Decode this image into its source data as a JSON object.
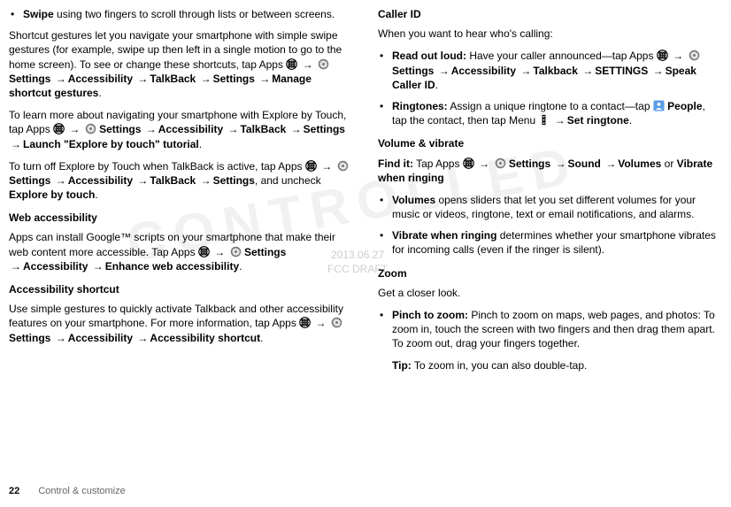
{
  "watermark": {
    "date": "2013.06.27",
    "label": "FCC DRAFT"
  },
  "left": {
    "swipe_bold": "Swipe",
    "swipe_rest": " using two fingers to scroll through lists or between screens.",
    "shortcut1": "Shortcut gestures let you navigate your smartphone with simple swipe gestures (for example, swipe up then left in a single motion to go to the home screen). To see or change these shortcuts, tap Apps ",
    "settings": "Settings",
    "accessibility": "Accessibility",
    "talkback": "TalkBack",
    "settings2": "Settings",
    "manage_gestures": "Manage shortcut gestures",
    "learn_more": "To learn more about navigating your smartphone with Explore by Touch, tap Apps ",
    "launch_tutorial": "Launch \"Explore by touch\" tutorial",
    "turnoff": "To turn off Explore by Touch when TalkBack is active, tap Apps ",
    "explore_by_touch": "Explore by touch",
    "uncheck_pre": ", and uncheck ",
    "web_heading": "Web accessibility",
    "web_text1": "Apps can install Google™ scripts on your smartphone that make their web content more accessible. Tap Apps ",
    "enhance_web": "Enhance web accessibility",
    "shortcut_heading": "Accessibility shortcut",
    "shortcut_text": "Use simple gestures to quickly activate Talkback and other accessibility features on your smartphone. For more information, tap Apps ",
    "accessibility_shortcut": "Accessibility shortcut"
  },
  "right": {
    "caller_heading": "Caller ID",
    "caller_intro": "When you want to hear who's calling:",
    "read_out": "Read out loud:",
    "read_rest": " Have your caller announced—tap Apps ",
    "talkback": "Talkback",
    "settings_caps": "SETTINGS",
    "speak_caller": "Speak Caller ID",
    "ringtones": "Ringtones:",
    "ringtones_rest": " Assign a unique ringtone to a contact—tap ",
    "people": "People",
    "tap_contact": ", tap the contact, then tap Menu ",
    "set_ringtone": "Set ringtone",
    "vol_heading": "Volume & vibrate",
    "find_it": "Find it:",
    "find_rest": " Tap Apps ",
    "sound": "Sound",
    "volumes": "Volumes",
    "or": " or ",
    "vibrate_when": "Vibrate when ringing",
    "vol_bullet1a": "Volumes",
    "vol_bullet1b": " opens sliders that let you set different volumes for your music or videos, ringtone, text or email notifications, and alarms.",
    "vol_bullet2a": "Vibrate when ringing",
    "vol_bullet2b": " determines whether your smartphone vibrates for incoming calls (even if the ringer is silent).",
    "zoom_heading": "Zoom",
    "zoom_intro": "Get a closer look.",
    "pinch": "Pinch to zoom:",
    "pinch_rest": " Pinch to zoom on maps, web pages, and photos: To zoom in, touch the screen with two fingers and then drag them apart. To zoom out, drag your fingers together.",
    "tip": "Tip:",
    "tip_rest": " To zoom in, you can also double-tap."
  },
  "footer": {
    "page": "22",
    "section": "Control & customize"
  },
  "labels": {
    "settings": "Settings",
    "accessibility": "Accessibility"
  }
}
